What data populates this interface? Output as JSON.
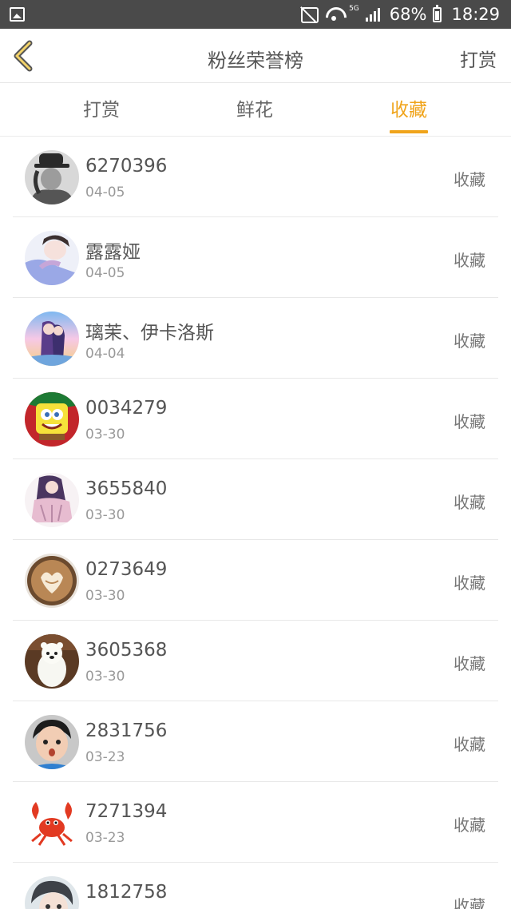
{
  "status_bar": {
    "battery": "68%",
    "time": "18:29",
    "network": "5G"
  },
  "header": {
    "title": "粉丝荣誉榜",
    "action_label": "打赏"
  },
  "tabs": [
    {
      "label": "打赏",
      "active": false
    },
    {
      "label": "鲜花",
      "active": false
    },
    {
      "label": "收藏",
      "active": true
    }
  ],
  "accent_color": "#f0a41b",
  "fans": [
    {
      "name": "6270396",
      "date": "04-05",
      "action": "收藏",
      "avatar": "bw-portrait"
    },
    {
      "name": "露露娅",
      "date": "04-05",
      "action": "收藏",
      "avatar": "girl-photo"
    },
    {
      "name": "璃茉、伊卡洛斯",
      "date": "04-04",
      "action": "收藏",
      "avatar": "anime-couple"
    },
    {
      "name": "0034279",
      "date": "03-30",
      "action": "收藏",
      "avatar": "sponge-cartoon"
    },
    {
      "name": "3655840",
      "date": "03-30",
      "action": "收藏",
      "avatar": "anime-girl"
    },
    {
      "name": "0273649",
      "date": "03-30",
      "action": "收藏",
      "avatar": "latte-art"
    },
    {
      "name": "3605368",
      "date": "03-30",
      "action": "收藏",
      "avatar": "polar-bear"
    },
    {
      "name": "2831756",
      "date": "03-23",
      "action": "收藏",
      "avatar": "boy-photo"
    },
    {
      "name": "7271394",
      "date": "03-23",
      "action": "收藏",
      "avatar": "red-crab"
    },
    {
      "name": "1812758",
      "date": "",
      "action": "收藏",
      "avatar": "girl-closeup"
    }
  ]
}
